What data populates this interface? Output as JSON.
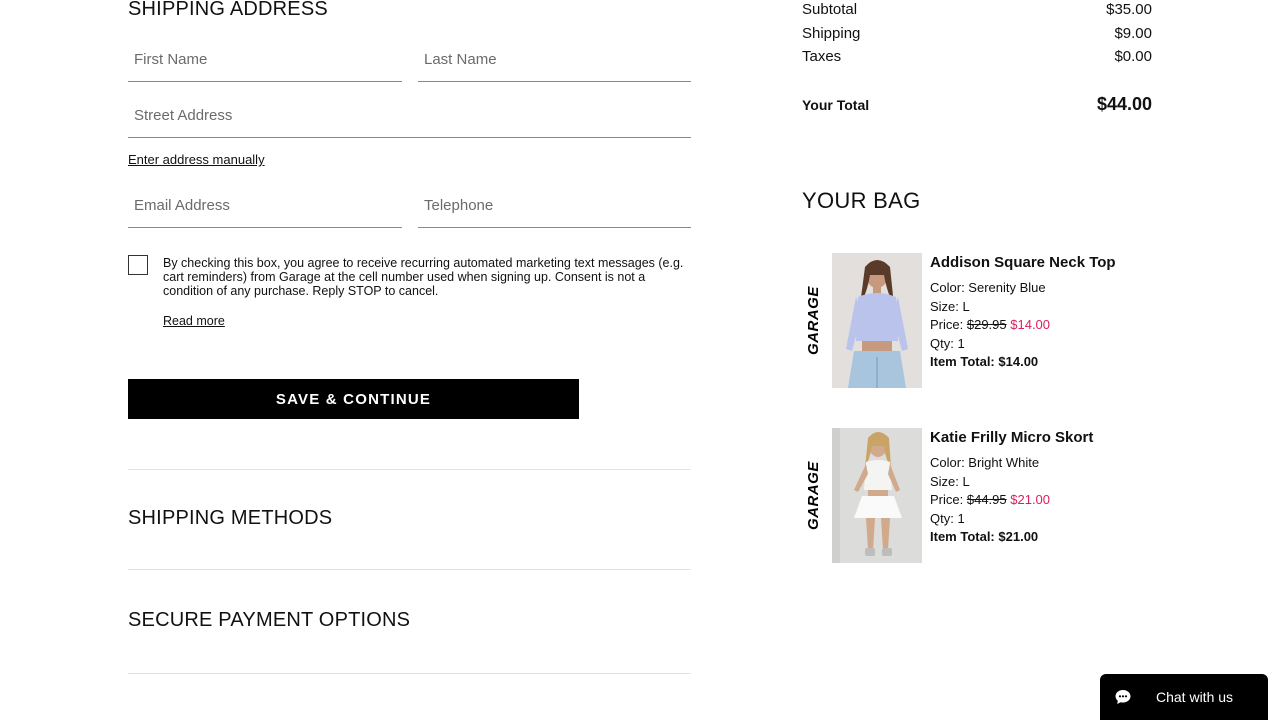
{
  "shipping_address": {
    "title": "SHIPPING ADDRESS",
    "first_name_placeholder": "First Name",
    "last_name_placeholder": "Last Name",
    "street_placeholder": "Street Address",
    "manual_link": "Enter address manually",
    "email_placeholder": "Email Address",
    "telephone_placeholder": "Telephone",
    "consent_text": "By checking this box, you agree to receive recurring automated marketing text messages (e.g. cart reminders) from Garage at the cell number used when signing up. Consent is not a condition of any purchase. Reply STOP to cancel.",
    "read_more": "Read more",
    "save_button": "SAVE & CONTINUE"
  },
  "sections": {
    "shipping_methods": "SHIPPING METHODS",
    "payment_options": "SECURE PAYMENT OPTIONS"
  },
  "summary": {
    "subtotal_label": "Subtotal",
    "subtotal_value": "$35.00",
    "shipping_label": "Shipping",
    "shipping_value": "$9.00",
    "taxes_label": "Taxes",
    "taxes_value": "$0.00",
    "total_label": "Your Total",
    "total_value": "$44.00"
  },
  "bag": {
    "title": "YOUR BAG",
    "items": [
      {
        "brand": "GARAGE",
        "name": "Addison Square Neck Top",
        "color": "Color: Serenity Blue",
        "size": "Size: L",
        "price_label": "Price:",
        "original_price": "$29.95",
        "sale_price": "$14.00",
        "qty": "Qty: 1",
        "item_total_label": "Item Total:",
        "item_total": "$14.00"
      },
      {
        "brand": "GARAGE",
        "name": "Katie Frilly Micro Skort",
        "color": "Color: Bright White",
        "size": "Size: L",
        "price_label": "Price:",
        "original_price": "$44.95",
        "sale_price": "$21.00",
        "qty": "Qty: 1",
        "item_total_label": "Item Total:",
        "item_total": "$21.00"
      }
    ]
  },
  "chat": {
    "label": "Chat with us",
    "icon": "chat-bubble-icon"
  },
  "colors": {
    "primary": "#000000",
    "sale": "#d9225b",
    "divider": "#e3e3e3"
  }
}
